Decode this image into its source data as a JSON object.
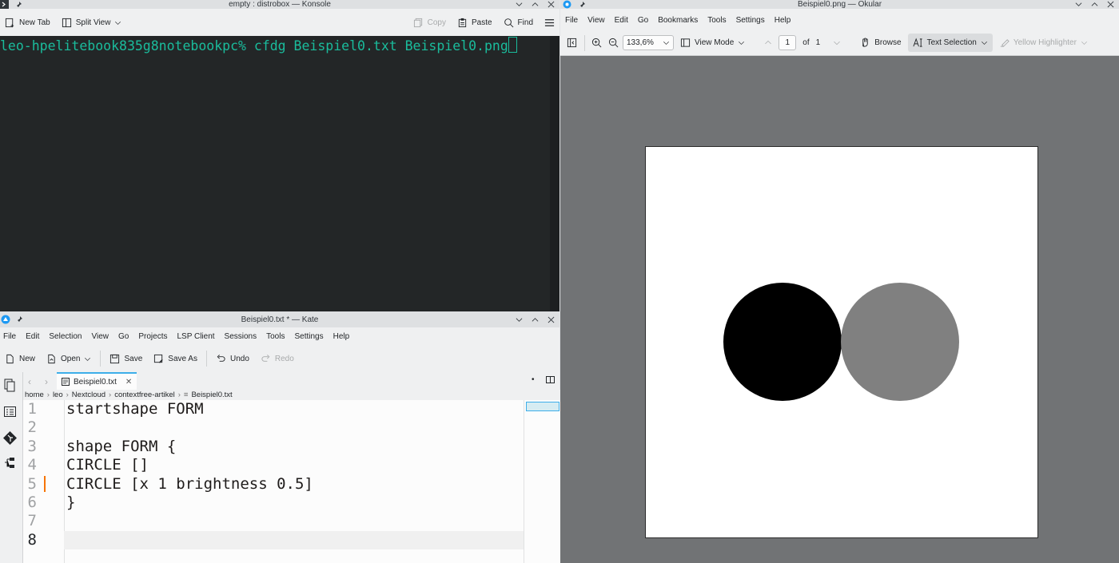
{
  "konsole": {
    "title": "empty : distrobox — Konsole",
    "toolbar": {
      "new_tab": "New Tab",
      "split_view": "Split View",
      "copy": "Copy",
      "paste": "Paste",
      "find": "Find"
    },
    "prompt": "leo-hpelitebook835g8notebookpc% cfdg Beispiel0.txt Beispiel0.png"
  },
  "kate": {
    "title": "Beispiel0.txt * — Kate",
    "menu": [
      "File",
      "Edit",
      "Selection",
      "View",
      "Go",
      "Projects",
      "LSP Client",
      "Sessions",
      "Tools",
      "Settings",
      "Help"
    ],
    "toolbar": {
      "new": "New",
      "open": "Open",
      "save": "Save",
      "save_as": "Save As",
      "undo": "Undo",
      "redo": "Redo"
    },
    "tab": "Beispiel0.txt",
    "breadcrumb": [
      "home",
      "leo",
      "Nextcloud",
      "contextfree-artikel",
      "Beispiel0.txt"
    ],
    "lines": [
      {
        "n": "1",
        "text": "startshape FORM"
      },
      {
        "n": "2",
        "text": ""
      },
      {
        "n": "3",
        "text": "shape FORM {"
      },
      {
        "n": "4",
        "text": "CIRCLE []"
      },
      {
        "n": "5",
        "text": "CIRCLE [x 1 brightness 0.5]"
      },
      {
        "n": "6",
        "text": "}"
      },
      {
        "n": "7",
        "text": ""
      },
      {
        "n": "8",
        "text": ""
      }
    ],
    "current_line": "8",
    "modified_line": "5"
  },
  "okular": {
    "title": "Beispiel0.png — Okular",
    "menu": [
      "File",
      "View",
      "Edit",
      "Go",
      "Bookmarks",
      "Tools",
      "Settings",
      "Help"
    ],
    "zoom": "133,6%",
    "view_mode": "View Mode",
    "page": "1",
    "of_label": "of",
    "total_pages": "1",
    "browse": "Browse",
    "text_selection": "Text Selection",
    "highlighter": "Yellow Highlighter",
    "circles": [
      {
        "name": "black-circle",
        "color": "#000000"
      },
      {
        "name": "gray-circle",
        "color": "#808080"
      }
    ]
  }
}
